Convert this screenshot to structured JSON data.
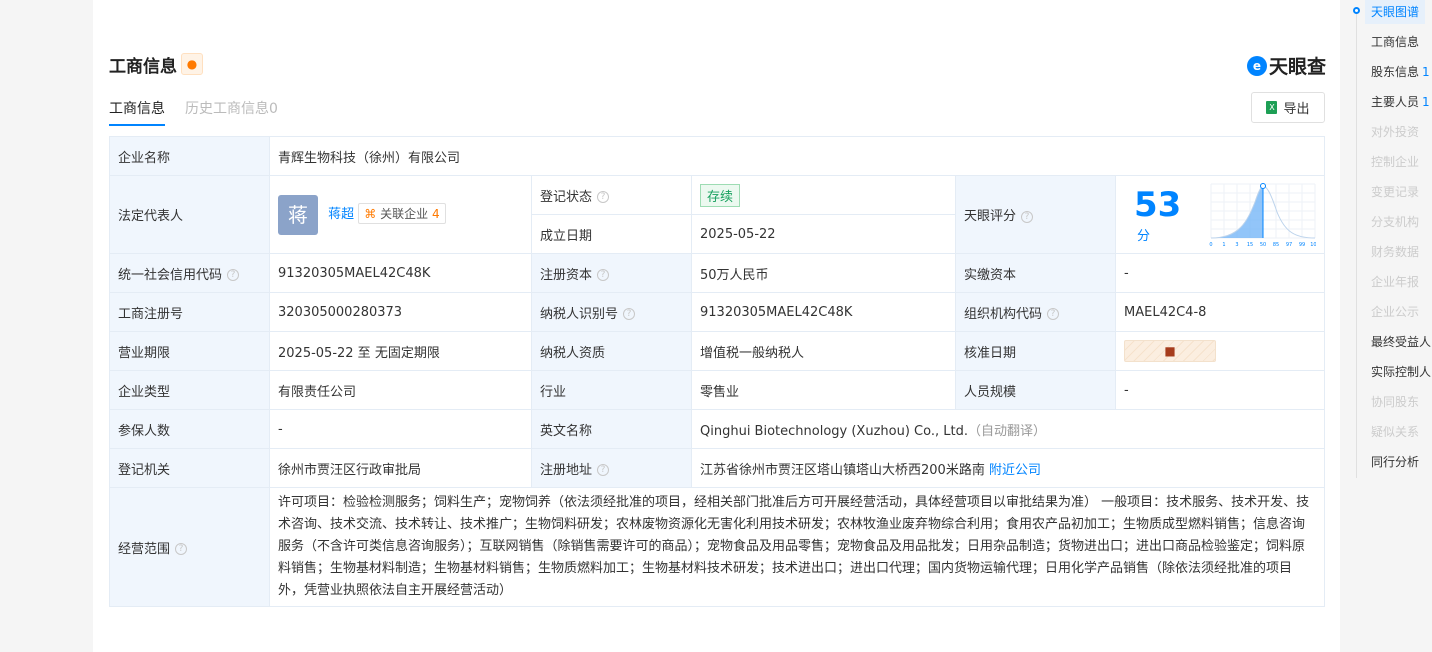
{
  "header": {
    "title": "工商信息",
    "brand": "天眼查",
    "export_label": "导出"
  },
  "tabs": [
    {
      "label": "工商信息"
    },
    {
      "label": "历史工商信息0"
    }
  ],
  "info": {
    "company_name_label": "企业名称",
    "company_name": "青辉生物科技（徐州）有限公司",
    "legal_rep_label": "法定代表人",
    "legal_rep_avatar": "蒋",
    "legal_rep": "蒋超",
    "related_label": "关联企业",
    "related_count": "4",
    "status_label": "登记状态",
    "status": "存续",
    "found_label": "成立日期",
    "found": "2025-05-22",
    "score_label": "天眼评分",
    "score": "53",
    "score_unit": "分",
    "credit_label": "统一社会信用代码",
    "credit": "91320305MAEL42C48K",
    "capital_label": "注册资本",
    "capital": "50万人民币",
    "paid_label": "实缴资本",
    "paid": "-",
    "reg_no_label": "工商注册号",
    "reg_no": "320305000280373",
    "tax_id_label": "纳税人识别号",
    "tax_id": "91320305MAEL42C48K",
    "org_code_label": "组织机构代码",
    "org_code": "MAEL42C4-8",
    "term_label": "营业期限",
    "term": "2025-05-22 至 无固定期限",
    "tax_qual_label": "纳税人资质",
    "tax_qual": "增值税一般纳税人",
    "approve_label": "核准日期",
    "type_label": "企业类型",
    "type": "有限责任公司",
    "industry_label": "行业",
    "industry": "零售业",
    "staff_label": "人员规模",
    "staff": "-",
    "insured_label": "参保人数",
    "insured": "-",
    "en_name_label": "英文名称",
    "en_name": "Qinghui Biotechnology (Xuzhou) Co., Ltd.",
    "en_note": "（自动翻译）",
    "authority_label": "登记机关",
    "authority": "徐州市贾汪区行政审批局",
    "address_label": "注册地址",
    "address": "江苏省徐州市贾汪区塔山镇塔山大桥西200米路南",
    "nearby": "附近公司",
    "scope_label": "经营范围",
    "scope": "许可项目：检验检测服务；饲料生产；宠物饲养（依法须经批准的项目，经相关部门批准后方可开展经营活动，具体经营项目以审批结果为准） 一般项目：技术服务、技术开发、技术咨询、技术交流、技术转让、技术推广；生物饲料研发；农林废物资源化无害化利用技术研发；农林牧渔业废弃物综合利用；食用农产品初加工；生物质成型燃料销售；信息咨询服务（不含许可类信息咨询服务）；互联网销售（除销售需要许可的商品）；宠物食品及用品零售；宠物食品及用品批发；日用杂品制造；货物进出口；进出口商品检验鉴定；饲料原料销售；生物基材料制造；生物基材料销售；生物质燃料加工；生物基材料技术研发；技术进出口；进出口代理；国内货物运输代理；日用化学产品销售（除依法须经批准的项目外，凭营业执照依法自主开展经营活动）"
  },
  "chart_data": {
    "type": "area",
    "title": "天眼评分分布",
    "x_ticks": [
      "0",
      "1",
      "3",
      "15",
      "50",
      "85",
      "97",
      "99",
      "100"
    ],
    "marker_value": 53,
    "accent": "#0084ff"
  },
  "sidebar": [
    {
      "label": "天眼图谱",
      "state": "on"
    },
    {
      "label": "工商信息",
      "state": "normal"
    },
    {
      "label": "股东信息",
      "count": "1",
      "state": "normal"
    },
    {
      "label": "主要人员",
      "count": "1",
      "state": "normal"
    },
    {
      "label": "对外投资",
      "state": "dis"
    },
    {
      "label": "控制企业",
      "state": "dis"
    },
    {
      "label": "变更记录",
      "state": "dis"
    },
    {
      "label": "分支机构",
      "state": "dis"
    },
    {
      "label": "财务数据",
      "state": "dis"
    },
    {
      "label": "企业年报",
      "state": "dis"
    },
    {
      "label": "企业公示",
      "state": "dis"
    },
    {
      "label": "最终受益人",
      "state": "normal"
    },
    {
      "label": "实际控制人",
      "state": "normal"
    },
    {
      "label": "协同股东",
      "state": "dis"
    },
    {
      "label": "疑似关系",
      "state": "dis"
    },
    {
      "label": "同行分析",
      "state": "normal"
    }
  ]
}
